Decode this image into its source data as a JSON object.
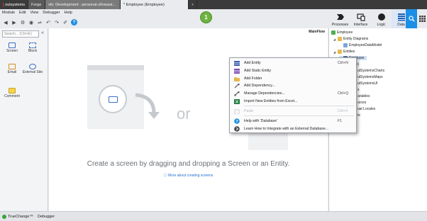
{
  "tabs": {
    "logo": "outsystems",
    "forge": "Forge",
    "dev": "vfs: Development - personal-z6nwast...",
    "active": "* Employee (Employee)",
    "add": "+"
  },
  "menu": {
    "items": [
      "Module",
      "Edit",
      "View",
      "Debugger",
      "Help"
    ]
  },
  "step_badge": "1",
  "topright": {
    "processes": "Processes",
    "interface": "Interface",
    "logic": "Logic",
    "data": "Data"
  },
  "left": {
    "search_placeholder": "Search... (Ctrl+E)",
    "widgets": [
      "Screen",
      "Block",
      "Email",
      "External Site",
      "Comment"
    ]
  },
  "canvas": {
    "mainflow": "MainFlow",
    "or": "or",
    "drop_text": "Create a screen by dragging and dropping a Screen or an Entity.",
    "learn_link": "More about creating screens"
  },
  "tree": {
    "rows": [
      "Employee",
      "Entity Diagrams",
      "EmployeeDataModel",
      "Entities",
      "Database",
      "(System)",
      "OutSystemsCharts",
      "OutSystemsMaps",
      "OutSystemsUI",
      "Structures",
      "Variables",
      "Resources",
      "Multilingual Locales",
      "Themes"
    ],
    "partial_rows": [
      "(System)",
      "utSystemsCharts",
      "utSystemsMaps",
      "utSystemsUI",
      "s",
      "ariables",
      "urces",
      "ual Locales",
      "ts"
    ]
  },
  "context_menu": {
    "items": [
      {
        "label": "Add Entity",
        "shortcut": "Ctrl+N",
        "disabled": false,
        "icon": "entity-icon"
      },
      {
        "label": "Add Static Entity",
        "shortcut": "",
        "disabled": false,
        "icon": "static-entity-icon"
      },
      {
        "label": "Add Folder",
        "shortcut": "",
        "disabled": false,
        "icon": "folder-icon"
      },
      {
        "label": "Add Dependency...",
        "shortcut": "",
        "disabled": false,
        "icon": "dependency-icon"
      },
      {
        "label": "Manage Dependencies...",
        "shortcut": "Ctrl+Q",
        "disabled": false,
        "icon": "manage-dependencies-icon"
      },
      {
        "label": "Import New Entities from Excel...",
        "shortcut": "",
        "disabled": false,
        "icon": "excel-icon"
      },
      {
        "label": "Paste",
        "shortcut": "Ctrl+V",
        "disabled": true,
        "icon": "paste-icon"
      },
      {
        "label": "Help with 'Database'",
        "shortcut": "F1",
        "disabled": false,
        "icon": "help-icon"
      },
      {
        "label": "Learn How to Integrate with an External Database...",
        "shortcut": "",
        "disabled": false,
        "icon": "external-db-icon"
      }
    ]
  },
  "bottom": {
    "truechange": "TrueChange™",
    "debugger": "Debugger"
  },
  "colors": {
    "accent": "#1b8fe6",
    "brand_red": "#e0312c",
    "step_green": "#6cb33f"
  }
}
